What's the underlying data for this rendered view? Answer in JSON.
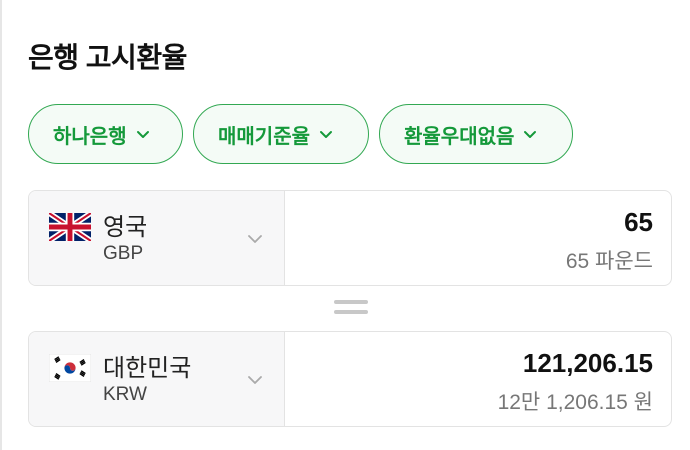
{
  "title": "은행 고시환율",
  "filters": [
    {
      "label": "하나은행",
      "icon": "chevron-down-icon"
    },
    {
      "label": "매매기준율",
      "icon": "chevron-down-icon"
    },
    {
      "label": "환율우대없음",
      "icon": "chevron-down-icon"
    }
  ],
  "from": {
    "flag": "uk-flag-icon",
    "name": "영국",
    "code": "GBP",
    "amount": "65",
    "amount_text": "65 파운드"
  },
  "to": {
    "flag": "kr-flag-icon",
    "name": "대한민국",
    "code": "KRW",
    "amount": "121,206.15",
    "amount_text": "12만 1,206.15 원"
  },
  "colors": {
    "accent": "#14993a",
    "chip_border": "#32a852",
    "chip_bg": "#f4fbf6"
  }
}
